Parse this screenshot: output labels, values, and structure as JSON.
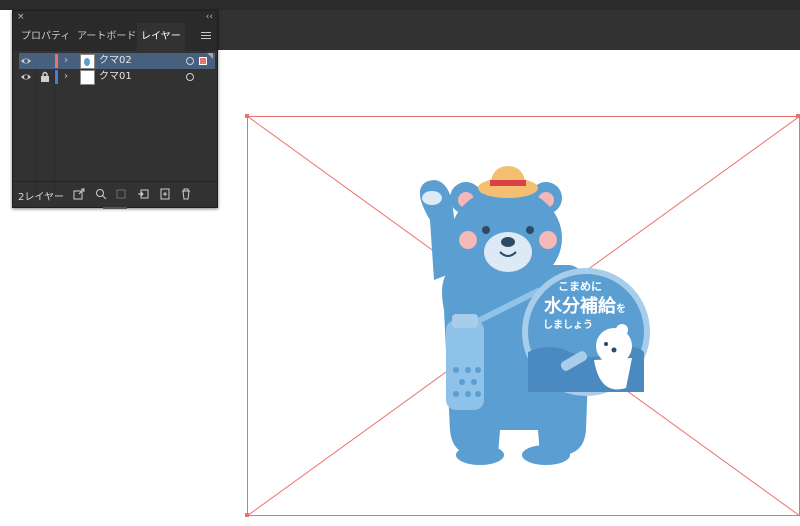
{
  "panel": {
    "close_glyph": "×",
    "collapse_glyph": "‹‹",
    "tabs": [
      {
        "label": "プロパティ",
        "active": false
      },
      {
        "label": "アートボード",
        "active": false
      },
      {
        "label": "レイヤー",
        "active": true
      }
    ],
    "layers": [
      {
        "name": "クマ02",
        "color": "#ea7272",
        "selected": true,
        "visible": true,
        "locked": false
      },
      {
        "name": "クマ01",
        "color": "#4a7fd4",
        "selected": false,
        "visible": true,
        "locked": true
      }
    ],
    "footer": {
      "layer_count": "2レイヤー"
    }
  },
  "illustration": {
    "badge_line1": "こまめに",
    "badge_line2": "水分補給",
    "badge_line2_suffix": "を",
    "badge_line3": "しましょう"
  },
  "colors": {
    "bear": "#5b9fd2",
    "bear_dark": "#4a8ac0",
    "muzzle": "#ddeaf6",
    "cheek": "#f5b7b8",
    "hat": "#f2c070",
    "hat_band": "#d94047",
    "badge": "#5b9fd2",
    "badge_ring": "#a8cdea",
    "bottle": "#8fc2e8",
    "artboard_guide": "#ea7272"
  }
}
